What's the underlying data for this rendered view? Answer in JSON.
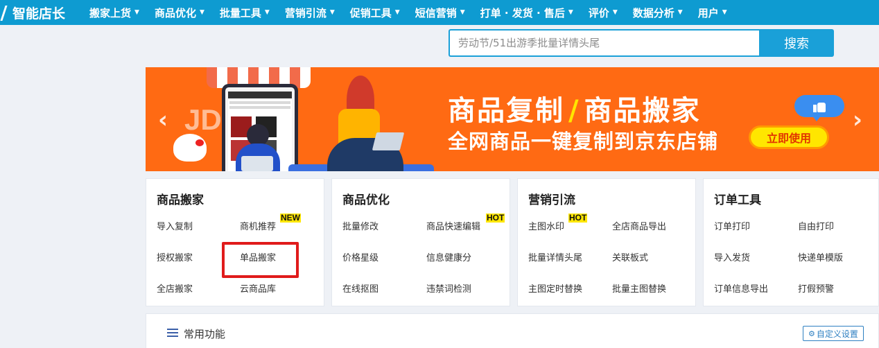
{
  "nav": {
    "logo": "智能店长",
    "items": [
      {
        "label": "搬家上货"
      },
      {
        "label": "商品优化"
      },
      {
        "label": "批量工具"
      },
      {
        "label": "营销引流"
      },
      {
        "label": "促销工具"
      },
      {
        "label": "短信营销"
      },
      {
        "label": "打单 · 发货 · 售后"
      },
      {
        "label": "评价"
      },
      {
        "label": "数据分析"
      },
      {
        "label": "用户"
      }
    ],
    "caret": "▼"
  },
  "search": {
    "placeholder": "劳动节/51出游季批量详情头尾",
    "button_label": "搜索"
  },
  "banner": {
    "title_left": "商品复制",
    "title_slash": "/",
    "title_right": "商品搬家",
    "subtitle": "全网商品一键复制到京东店铺",
    "cta_label": "立即使用",
    "brand_mark": "JD",
    "prev_arrow": "‹",
    "next_arrow": "›",
    "accent_color": "#ff6a13"
  },
  "cards": [
    {
      "title": "商品搬家",
      "links": [
        {
          "label": "导入复制"
        },
        {
          "label": "商机推荐",
          "badge": "NEW"
        },
        {
          "label": "授权搬家"
        },
        {
          "label": "单品搬家"
        },
        {
          "label": "全店搬家"
        },
        {
          "label": "云商品库"
        }
      ]
    },
    {
      "title": "商品优化",
      "links": [
        {
          "label": "批量修改"
        },
        {
          "label": "商品快速编辑",
          "badge": "HOT"
        },
        {
          "label": "价格星级"
        },
        {
          "label": "信息健康分"
        },
        {
          "label": "在线抠图"
        },
        {
          "label": "违禁词检测"
        }
      ]
    },
    {
      "title": "营销引流",
      "links": [
        {
          "label": "主图水印",
          "badge": "HOT"
        },
        {
          "label": "全店商品导出"
        },
        {
          "label": "批量详情头尾"
        },
        {
          "label": "关联板式"
        },
        {
          "label": "主图定时替换"
        },
        {
          "label": "批量主图替换"
        }
      ]
    },
    {
      "title": "订单工具",
      "links": [
        {
          "label": "订单打印"
        },
        {
          "label": "自由打印"
        },
        {
          "label": "导入发货"
        },
        {
          "label": "快递单模版"
        },
        {
          "label": "订单信息导出"
        },
        {
          "label": "打假预警"
        }
      ]
    }
  ],
  "common": {
    "title": "常用功能",
    "custom_label": "自定义设置",
    "gear_glyph": "⚙"
  }
}
